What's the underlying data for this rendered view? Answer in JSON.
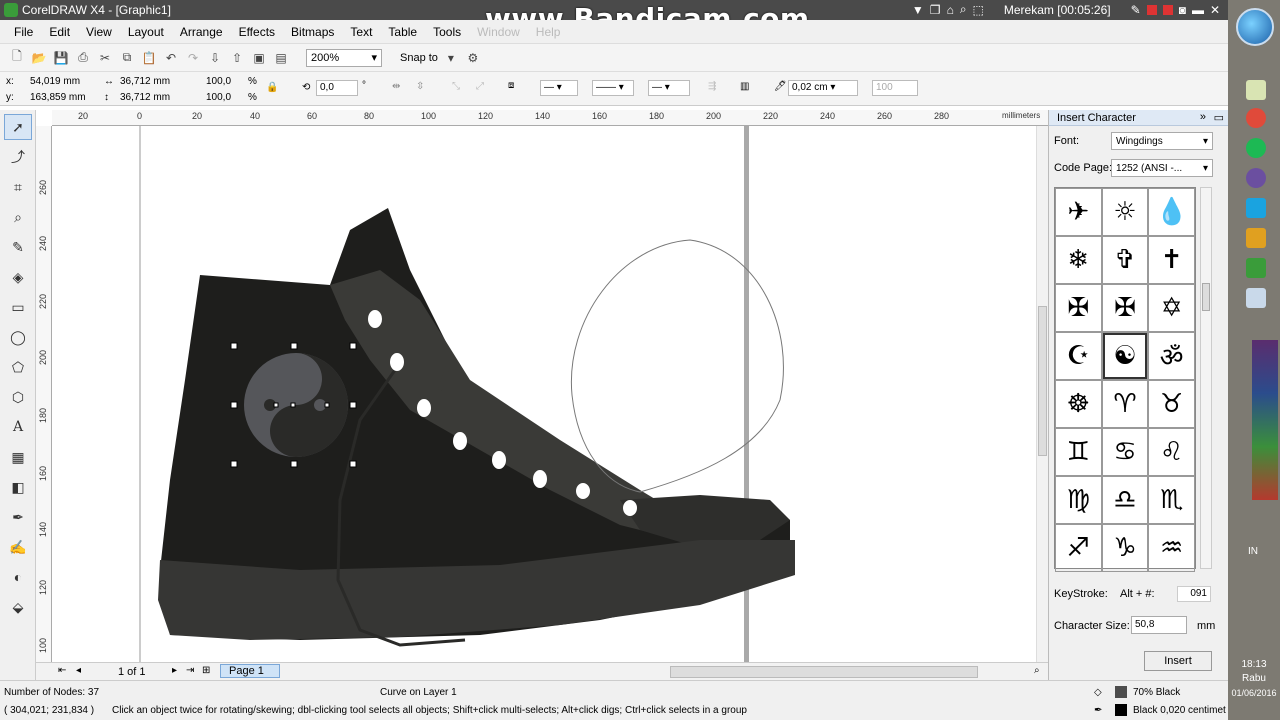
{
  "window": {
    "title": "CorelDRAW X4 - [Graphic1]"
  },
  "watermark": "www.Bandicam.com",
  "recording": "Merekam [00:05:26]",
  "menu": [
    "File",
    "Edit",
    "View",
    "Layout",
    "Arrange",
    "Effects",
    "Bitmaps",
    "Text",
    "Table",
    "Tools",
    "Window",
    "Help"
  ],
  "toolbar": {
    "zoom": "200%",
    "snap_label": "Snap to"
  },
  "propbar": {
    "x": "54,019 mm",
    "y": "163,859 mm",
    "w": "36,712 mm",
    "h": "36,712 mm",
    "scale_x": "100,0",
    "scale_y": "100,0",
    "pct": "%",
    "angle": "0,0",
    "deg": "°",
    "outline_width": "0,02 cm",
    "opacity": "100"
  },
  "ruler": {
    "h_ticks": [
      "20",
      "0",
      "20",
      "40",
      "60",
      "80",
      "100",
      "120",
      "140",
      "160",
      "180",
      "200",
      "220",
      "240",
      "260",
      "280"
    ],
    "v_ticks": [
      "260",
      "240",
      "220",
      "200",
      "180",
      "160",
      "140",
      "120",
      "100"
    ],
    "unit": "millimeters"
  },
  "page_nav": {
    "counter": "1 of 1",
    "page_tab": "Page 1"
  },
  "docker": {
    "title": "Insert Character",
    "font_label": "Font:",
    "font_value": "Wingdings",
    "codepage_label": "Code Page:",
    "codepage_value": "1252 (ANSI -...",
    "glyphs": [
      "✈",
      "☼",
      "💧",
      "❄",
      "✞",
      "✝",
      "✠",
      "✠",
      "✡",
      "☪",
      "☯",
      "ॐ",
      "☸",
      "♈",
      "♉",
      "♊",
      "♋",
      "♌",
      "♍",
      "♎",
      "♏",
      "♐",
      "♑",
      "♒"
    ],
    "keystroke_label": "KeyStroke:",
    "keystroke_combo": "Alt + #:",
    "keystroke_value": "091",
    "charsize_label": "Character Size:",
    "charsize_value": "50,8",
    "charsize_unit": "mm",
    "insert_label": "Insert"
  },
  "status": {
    "nodes": "Number of Nodes: 37",
    "object": "Curve on Layer 1",
    "coords": "( 304,021; 231,834 )",
    "hint": "Click an object twice for rotating/skewing; dbl-clicking tool selects all objects; Shift+click multi-selects; Alt+click digs; Ctrl+click selects in a group",
    "fill": "70% Black",
    "outline": "Black  0,020 centimet"
  },
  "clock": {
    "time": "18:13",
    "day": "Rabu",
    "date": "01/06/2016",
    "lang": "IN"
  },
  "colors": {
    "shoe_dark": "#1e1e1c",
    "shoe_mid": "#3a3a37",
    "shoe_sole": "#363634",
    "yin_yang": "#55565a"
  }
}
